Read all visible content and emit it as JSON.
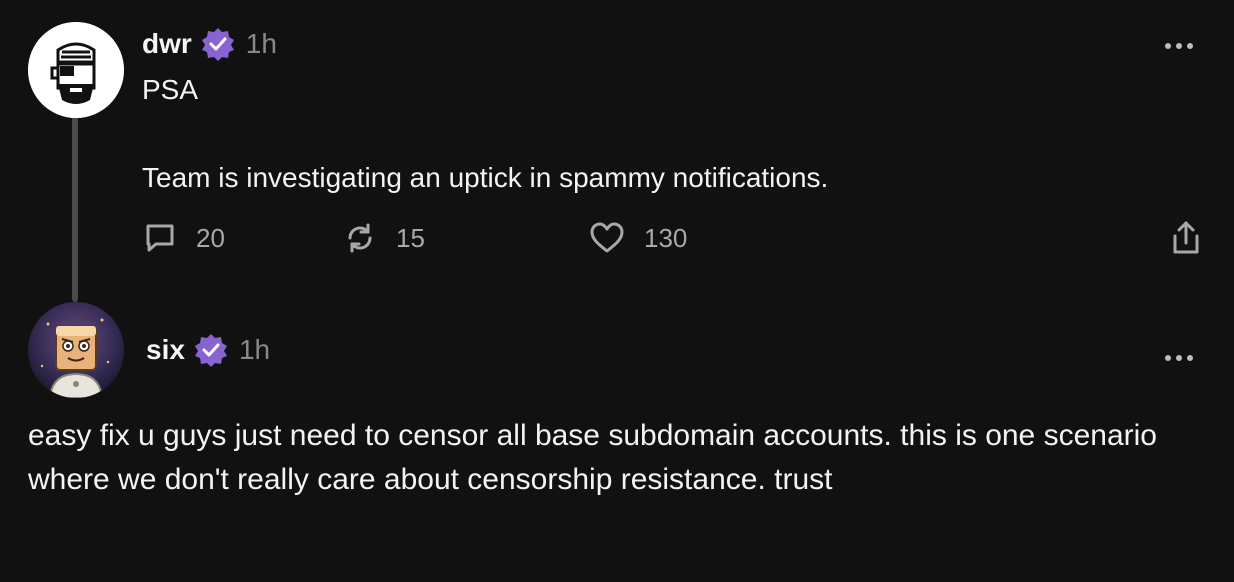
{
  "post": {
    "username": "dwr",
    "time": "1h",
    "text": "PSA\n\nTeam is investigating an uptick in spammy notifications.",
    "replies_count": "20",
    "recasts_count": "15",
    "likes_count": "130"
  },
  "reply": {
    "username": "six",
    "time": "1h",
    "text": "easy fix u guys just need to censor all base subdomain accounts. this is one scenario where we don't really care about censorship resistance. trust"
  },
  "colors": {
    "background": "#111111",
    "verified_badge": "#8A63D2",
    "muted_text": "#8a8a8a",
    "thread_line": "#4a4a4a"
  },
  "icons": {
    "reply": "comment-bubble-icon",
    "recast": "recast-icon",
    "like": "heart-icon",
    "share": "share-icon",
    "more": "more-dots-icon",
    "verified": "verified-badge-icon"
  }
}
